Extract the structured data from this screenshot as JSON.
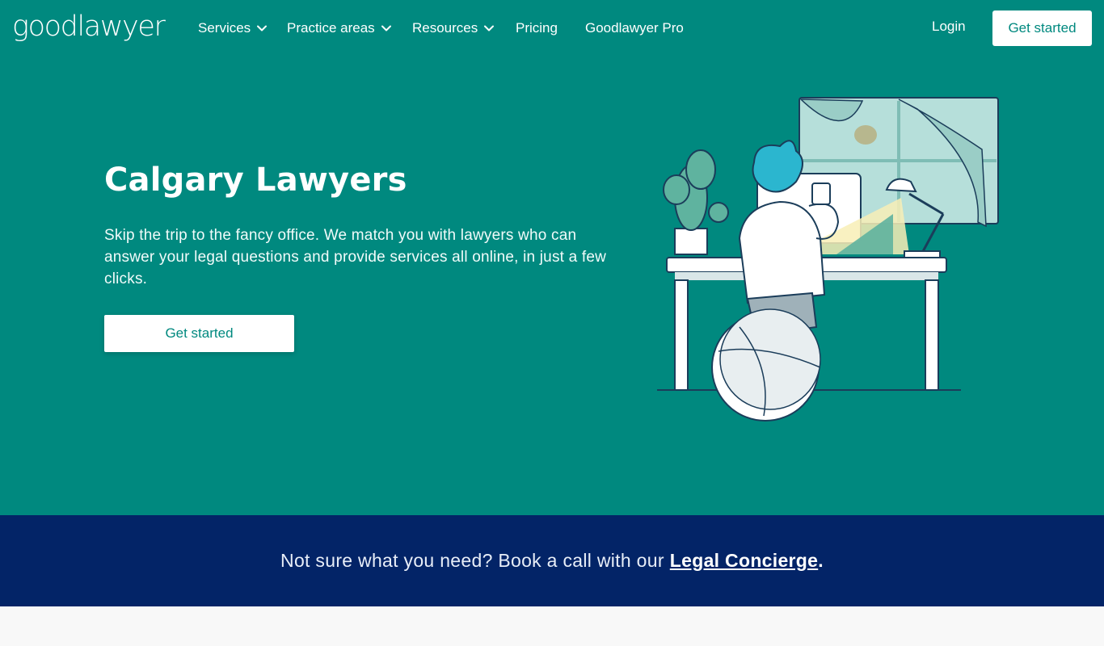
{
  "nav": {
    "logo": "goodlawyer",
    "items": [
      {
        "label": "Services",
        "has_dropdown": true
      },
      {
        "label": "Practice areas",
        "has_dropdown": true
      },
      {
        "label": "Resources",
        "has_dropdown": true
      },
      {
        "label": "Pricing",
        "has_dropdown": false
      },
      {
        "label": "Goodlawyer Pro",
        "has_dropdown": false
      }
    ],
    "login": "Login",
    "cta": "Get started"
  },
  "hero": {
    "title": "Calgary Lawyers",
    "description": "Skip the trip to the fancy office. We match you with lawyers who can answer your legal questions and provide services all online, in just a few clicks.",
    "cta": "Get started"
  },
  "banner": {
    "text": "Not sure what you need? Book a call with our",
    "link": "Legal Concierge",
    "suffix": "."
  },
  "colors": {
    "brand_teal": "#00897f",
    "banner_navy": "#032467",
    "accent_cyan": "#2bb6cf",
    "page_bg": "#f8f8f8"
  },
  "icons": [
    "chevron-down-icon"
  ]
}
